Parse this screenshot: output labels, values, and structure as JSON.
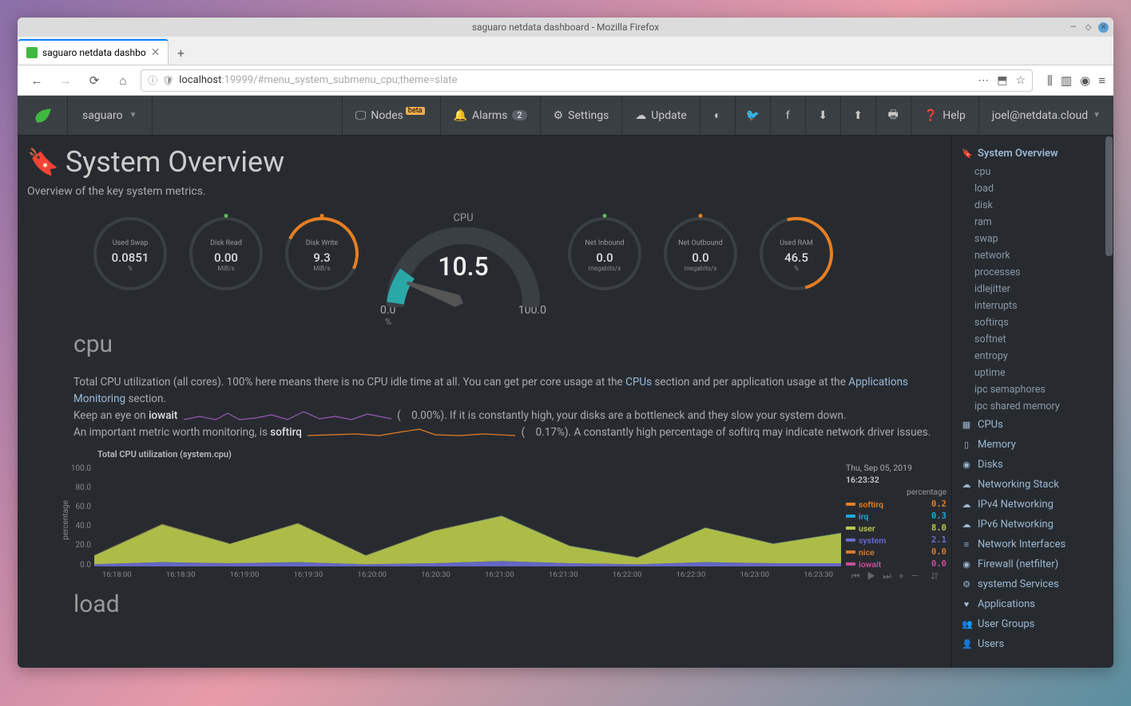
{
  "window": {
    "title": "saguaro netdata dashboard - Mozilla Firefox"
  },
  "browser": {
    "tab_title": "saguaro netdata dashbo",
    "url_host": "localhost",
    "url_path": ":19999/#menu_system_submenu_cpu;theme=slate"
  },
  "navbar": {
    "host": "saguaro",
    "nodes": "Nodes",
    "nodes_badge": "beta",
    "alarms": "Alarms",
    "alarms_count": "2",
    "settings": "Settings",
    "update": "Update",
    "help": "Help",
    "user": "joel@netdata.cloud"
  },
  "page": {
    "title": "System Overview",
    "subtitle": "Overview of the key system metrics."
  },
  "gauges": {
    "swap": {
      "label": "Used Swap",
      "value": "0.0851",
      "unit": "%",
      "color": "#999"
    },
    "diskread": {
      "label": "Disk Read",
      "value": "0.00",
      "unit": "MiB/s",
      "dot": "#5fb85f"
    },
    "diskwrite": {
      "label": "Disk Write",
      "value": "9.3",
      "unit": "MiB/s",
      "dot": "#e67e22",
      "arc": true
    },
    "cpu": {
      "label": "CPU",
      "value": "10.5",
      "min": "0.0",
      "max": "100.0",
      "pct": "%"
    },
    "netin": {
      "label": "Net Inbound",
      "value": "0.0",
      "unit": "megabits/s",
      "dot": "#5fb85f"
    },
    "netout": {
      "label": "Net Outbound",
      "value": "0.0",
      "unit": "megabits/s",
      "dot": "#e67e22"
    },
    "ram": {
      "label": "Used RAM",
      "value": "46.5",
      "unit": "%",
      "dot": "#e67e22",
      "arc": true
    }
  },
  "cpu_section": {
    "heading": "cpu",
    "text_pre": "Total CPU utilization (all cores). 100% here means there is no CPU idle time at all. You can get per core usage at the ",
    "link1": "CPUs",
    "text_mid": " section and per application usage at the ",
    "link2": "Applications Monitoring",
    "text_after_link2": " section.",
    "line2_pre": "Keep an eye on ",
    "kw_iowait": "iowait",
    "iowait_val": "0.00%",
    "line2_post": "). If it is constantly high, your disks are a bottleneck and they slow your system down.",
    "line3_pre": "An important metric worth monitoring, is ",
    "kw_softirq": "softirq",
    "softirq_val": "0.17%",
    "line3_post": "). A constantly high percentage of softirq may indicate network driver issues."
  },
  "chart_data": {
    "type": "area",
    "title": "Total CPU utilization (system.cpu)",
    "ylabel": "percentage",
    "ylim": [
      0,
      100
    ],
    "yticks": [
      0.0,
      20.0,
      40.0,
      60.0,
      80.0,
      100.0
    ],
    "categories": [
      "16:18:00",
      "16:18:30",
      "16:19:00",
      "16:19:30",
      "16:20:00",
      "16:20:30",
      "16:21:00",
      "16:21:30",
      "16:22:00",
      "16:22:30",
      "16:23:00",
      "16:23:30"
    ],
    "timestamp_date": "Thu, Sep 05, 2019",
    "timestamp_time": "16:23:32",
    "legend_header": "percentage",
    "series": [
      {
        "name": "softirq",
        "color": "#e67e22",
        "value": "0.2",
        "values": [
          0.2,
          0.4,
          0.2,
          0.3,
          0.2,
          0.3,
          0.2,
          0.2,
          0.3,
          0.2,
          0.2,
          0.2
        ]
      },
      {
        "name": "irq",
        "color": "#1ca8dd",
        "value": "0.3",
        "values": [
          0.3,
          0.3,
          0.2,
          0.3,
          0.3,
          0.2,
          0.4,
          0.3,
          0.3,
          0.3,
          0.3,
          0.3
        ]
      },
      {
        "name": "user",
        "color": "#b8c94a",
        "value": "8.0",
        "values": [
          8,
          35,
          18,
          36,
          8,
          30,
          42,
          16,
          6,
          32,
          18,
          28
        ]
      },
      {
        "name": "system",
        "color": "#6a6bd1",
        "value": "2.1",
        "values": [
          2,
          4,
          3,
          4,
          2,
          3,
          5,
          3,
          2,
          4,
          3,
          3
        ]
      },
      {
        "name": "nice",
        "color": "#d97a2e",
        "value": "0.0",
        "values": [
          0,
          0,
          0,
          0,
          0,
          0,
          0,
          0,
          0,
          0,
          0,
          0
        ]
      },
      {
        "name": "iowait",
        "color": "#c94c9c",
        "value": "0.0",
        "values": [
          0,
          0,
          0,
          0,
          0,
          0,
          0,
          0,
          0,
          0,
          0,
          0
        ]
      }
    ]
  },
  "load_section": {
    "heading": "load"
  },
  "rightnav": {
    "active": {
      "icon": "🔖",
      "label": "System Overview"
    },
    "subs": [
      "cpu",
      "load",
      "disk",
      "ram",
      "swap",
      "network",
      "processes",
      "idlejitter",
      "interrupts",
      "softirqs",
      "softnet",
      "entropy",
      "uptime",
      "ipc semaphores",
      "ipc shared memory"
    ],
    "groups": [
      {
        "icon": "▦",
        "label": "CPUs"
      },
      {
        "icon": "▯",
        "label": "Memory"
      },
      {
        "icon": "◉",
        "label": "Disks"
      },
      {
        "icon": "☁",
        "label": "Networking Stack"
      },
      {
        "icon": "☁",
        "label": "IPv4 Networking"
      },
      {
        "icon": "☁",
        "label": "IPv6 Networking"
      },
      {
        "icon": "≡",
        "label": "Network Interfaces"
      },
      {
        "icon": "◉",
        "label": "Firewall (netfilter)"
      },
      {
        "icon": "⚙",
        "label": "systemd Services"
      },
      {
        "icon": "♥",
        "label": "Applications"
      },
      {
        "icon": "👥",
        "label": "User Groups"
      },
      {
        "icon": "👤",
        "label": "Users"
      }
    ]
  }
}
